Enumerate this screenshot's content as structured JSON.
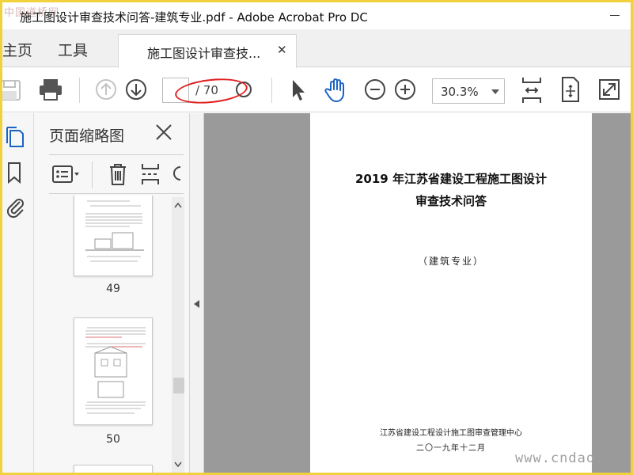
{
  "window": {
    "title": "施工图设计审查技术问答-建筑专业.pdf - Adobe Acrobat Pro DC",
    "logo_text": "中国道桥网",
    "close_glyph": "✕"
  },
  "tabs": {
    "home": "主页",
    "tools": "工具",
    "document": "施工图设计审查技...",
    "document_close": "✕"
  },
  "toolbar": {
    "page_total": "/ 70",
    "zoom": "30.3%"
  },
  "panel": {
    "title": "页面缩略图",
    "close": "✕"
  },
  "thumbnails": [
    {
      "number": "49"
    },
    {
      "number": "50"
    }
  ],
  "document": {
    "title_line1": "2019 年江苏省建设工程施工图设计",
    "title_line2": "审查技术问答",
    "subtitle": "（建筑专业）",
    "organization": "江苏省建设工程设计施工图审查管理中心",
    "date": "二〇一九年十二月"
  },
  "watermark": "www.cndao.",
  "colors": {
    "frame": "#f2d23c",
    "annotation": "#e02020",
    "accent": "#1b64c4",
    "doc_background": "#9a9a9a"
  }
}
